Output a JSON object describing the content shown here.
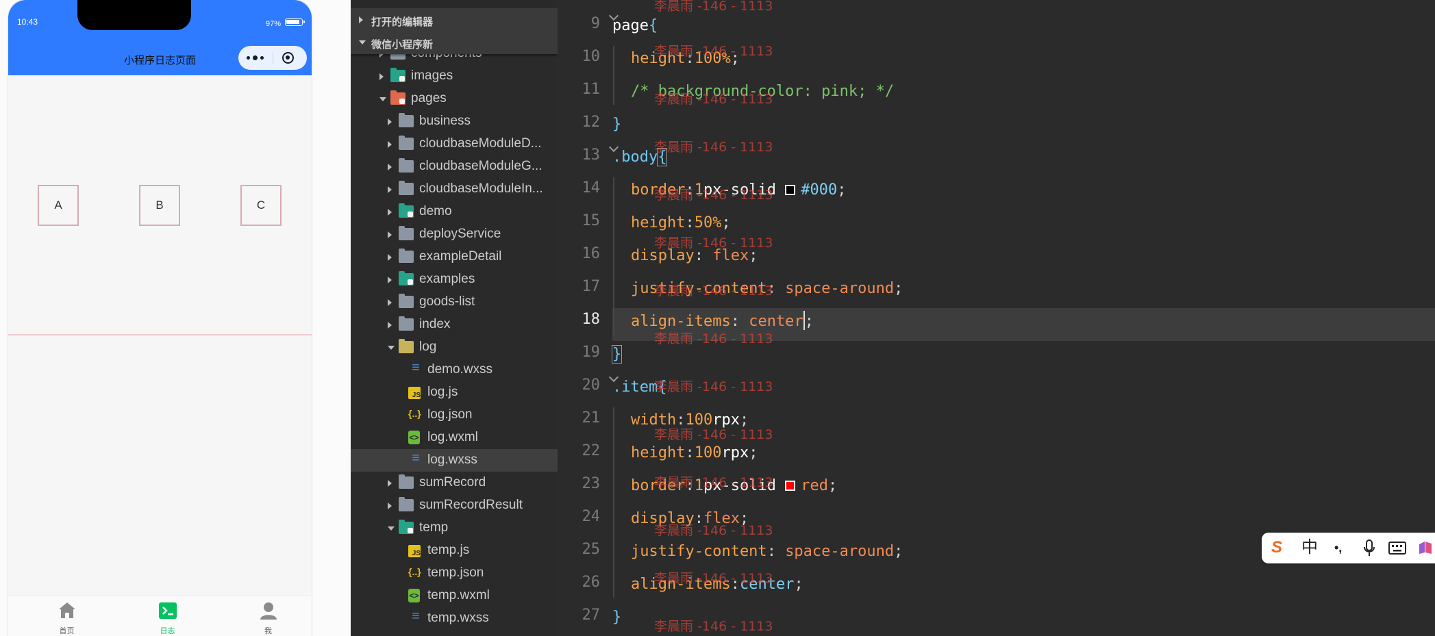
{
  "phone": {
    "status_time": "10:43",
    "battery": "97%",
    "title": "小程序日志页面",
    "items": [
      "A",
      "B",
      "C"
    ],
    "tabs": [
      {
        "label": "首页",
        "icon": "home-icon",
        "color": "#888888"
      },
      {
        "label": "日志",
        "icon": "terminal-icon",
        "color": "#07c160"
      },
      {
        "label": "我",
        "icon": "user-icon",
        "color": "#888888"
      }
    ]
  },
  "explorer": {
    "open_editors": "打开的编辑器",
    "project": "微信小程序新",
    "tree": [
      {
        "name": "components",
        "type": "folder",
        "level": 1,
        "open": false,
        "partial": true
      },
      {
        "name": "images",
        "type": "folder-teal",
        "level": 1,
        "open": false
      },
      {
        "name": "pages",
        "type": "folder-red",
        "level": 1,
        "open": true
      },
      {
        "name": "business",
        "type": "folder",
        "level": 2,
        "open": false
      },
      {
        "name": "cloudbaseModuleD...",
        "type": "folder",
        "level": 2,
        "open": false
      },
      {
        "name": "cloudbaseModuleG...",
        "type": "folder",
        "level": 2,
        "open": false
      },
      {
        "name": "cloudbaseModuleIn...",
        "type": "folder",
        "level": 2,
        "open": false
      },
      {
        "name": "demo",
        "type": "folder-teal",
        "level": 2,
        "open": false
      },
      {
        "name": "deployService",
        "type": "folder",
        "level": 2,
        "open": false
      },
      {
        "name": "exampleDetail",
        "type": "folder",
        "level": 2,
        "open": false
      },
      {
        "name": "examples",
        "type": "folder-teal",
        "level": 2,
        "open": false
      },
      {
        "name": "goods-list",
        "type": "folder",
        "level": 2,
        "open": false
      },
      {
        "name": "index",
        "type": "folder",
        "level": 2,
        "open": false
      },
      {
        "name": "log",
        "type": "folder-open",
        "level": 2,
        "open": true
      },
      {
        "name": "demo.wxss",
        "type": "css",
        "level": 3
      },
      {
        "name": "log.js",
        "type": "js",
        "level": 3
      },
      {
        "name": "log.json",
        "type": "json",
        "level": 3
      },
      {
        "name": "log.wxml",
        "type": "wxml",
        "level": 3
      },
      {
        "name": "log.wxss",
        "type": "css",
        "level": 3,
        "selected": true
      },
      {
        "name": "sumRecord",
        "type": "folder",
        "level": 2,
        "open": false
      },
      {
        "name": "sumRecordResult",
        "type": "folder",
        "level": 2,
        "open": false
      },
      {
        "name": "temp",
        "type": "folder-teal",
        "level": 2,
        "open": true
      },
      {
        "name": "temp.js",
        "type": "js",
        "level": 3
      },
      {
        "name": "temp.json",
        "type": "json",
        "level": 3
      },
      {
        "name": "temp.wxml",
        "type": "wxml",
        "level": 3
      },
      {
        "name": "temp.wxss",
        "type": "css",
        "level": 3
      }
    ]
  },
  "editor": {
    "first_line": 9,
    "active_line": 18,
    "watermark": "李晨雨 -146 - 1113",
    "lines": [
      {
        "n": 9,
        "indent": false,
        "fold": true,
        "tokens": [
          [
            "sel",
            "page"
          ],
          [
            "brace",
            "{"
          ]
        ]
      },
      {
        "n": 10,
        "indent": true,
        "tokens": [
          [
            "prop",
            "height"
          ],
          [
            "semi",
            ":"
          ],
          [
            "num",
            "100%"
          ],
          [
            "semi",
            ";"
          ]
        ]
      },
      {
        "n": 11,
        "indent": true,
        "tokens": [
          [
            "comment",
            "/* background-color: pink; */"
          ]
        ]
      },
      {
        "n": 12,
        "indent": false,
        "tokens": [
          [
            "brace",
            "}"
          ]
        ]
      },
      {
        "n": 13,
        "indent": false,
        "fold": true,
        "tokens": [
          [
            "cls",
            ".body"
          ],
          [
            "brace",
            "{"
          ]
        ]
      },
      {
        "n": 14,
        "indent": true,
        "tokens": [
          [
            "prop",
            "border"
          ],
          [
            "semi",
            ":"
          ],
          [
            "num",
            "1"
          ],
          [
            "unit",
            "px"
          ],
          [
            "semi",
            "-"
          ],
          [
            "str",
            "solid "
          ],
          [
            "swatch",
            "#000000"
          ],
          [
            "color",
            "#000"
          ],
          [
            "semi",
            ";"
          ]
        ]
      },
      {
        "n": 15,
        "indent": true,
        "tokens": [
          [
            "prop",
            "height"
          ],
          [
            "semi",
            ":"
          ],
          [
            "num",
            "50%"
          ],
          [
            "semi",
            ";"
          ]
        ]
      },
      {
        "n": 16,
        "indent": true,
        "tokens": [
          [
            "prop",
            "display"
          ],
          [
            "semi",
            ": "
          ],
          [
            "kw",
            "flex"
          ],
          [
            "semi",
            ";"
          ]
        ]
      },
      {
        "n": 17,
        "indent": true,
        "tokens": [
          [
            "prop",
            "justify-content"
          ],
          [
            "semi",
            ": "
          ],
          [
            "kw",
            "space-around"
          ],
          [
            "semi",
            ";"
          ]
        ]
      },
      {
        "n": 18,
        "indent": true,
        "tokens": [
          [
            "prop",
            "align-items"
          ],
          [
            "semi",
            ": "
          ],
          [
            "kw",
            "center"
          ],
          [
            "cursor",
            ""
          ],
          [
            "semi",
            ";"
          ]
        ]
      },
      {
        "n": 19,
        "indent": false,
        "tokens": [
          [
            "brace",
            "}"
          ]
        ]
      },
      {
        "n": 20,
        "indent": false,
        "fold": true,
        "tokens": [
          [
            "cls",
            ".item"
          ],
          [
            "brace",
            "{"
          ]
        ]
      },
      {
        "n": 21,
        "indent": true,
        "tokens": [
          [
            "prop",
            "width"
          ],
          [
            "semi",
            ":"
          ],
          [
            "num",
            "100"
          ],
          [
            "unit",
            "rpx"
          ],
          [
            "semi",
            ";"
          ]
        ]
      },
      {
        "n": 22,
        "indent": true,
        "tokens": [
          [
            "prop",
            "height"
          ],
          [
            "semi",
            ":"
          ],
          [
            "num",
            "100"
          ],
          [
            "unit",
            "rpx"
          ],
          [
            "semi",
            ";"
          ]
        ]
      },
      {
        "n": 23,
        "indent": true,
        "tokens": [
          [
            "prop",
            "border"
          ],
          [
            "semi",
            ":"
          ],
          [
            "num",
            "1"
          ],
          [
            "unit",
            "px"
          ],
          [
            "semi",
            "-"
          ],
          [
            "str",
            "solid "
          ],
          [
            "swatch",
            "#ff0000"
          ],
          [
            "kw",
            "red"
          ],
          [
            "semi",
            ";"
          ]
        ]
      },
      {
        "n": 24,
        "indent": true,
        "tokens": [
          [
            "prop",
            "display"
          ],
          [
            "semi",
            ":"
          ],
          [
            "kw",
            "flex"
          ],
          [
            "semi",
            ";"
          ]
        ]
      },
      {
        "n": 25,
        "indent": true,
        "tokens": [
          [
            "prop",
            "justify-content"
          ],
          [
            "semi",
            ": "
          ],
          [
            "kw",
            "space-around"
          ],
          [
            "semi",
            ";"
          ]
        ]
      },
      {
        "n": 26,
        "indent": true,
        "tokens": [
          [
            "prop",
            "align-items"
          ],
          [
            "semi",
            ":"
          ],
          [
            "color",
            "center"
          ],
          [
            "semi",
            ";"
          ]
        ]
      },
      {
        "n": 27,
        "indent": false,
        "tokens": [
          [
            "brace",
            "}"
          ]
        ]
      }
    ]
  },
  "ime": {
    "items": [
      {
        "icon": "sogou-logo-icon",
        "text": "S"
      },
      {
        "icon": "chinese-mode-icon",
        "text": "中"
      },
      {
        "icon": "punctuation-icon",
        "text": "•,"
      },
      {
        "icon": "microphone-icon",
        "text": ""
      },
      {
        "icon": "keyboard-icon",
        "text": ""
      },
      {
        "icon": "skin-icon",
        "text": ""
      }
    ]
  }
}
